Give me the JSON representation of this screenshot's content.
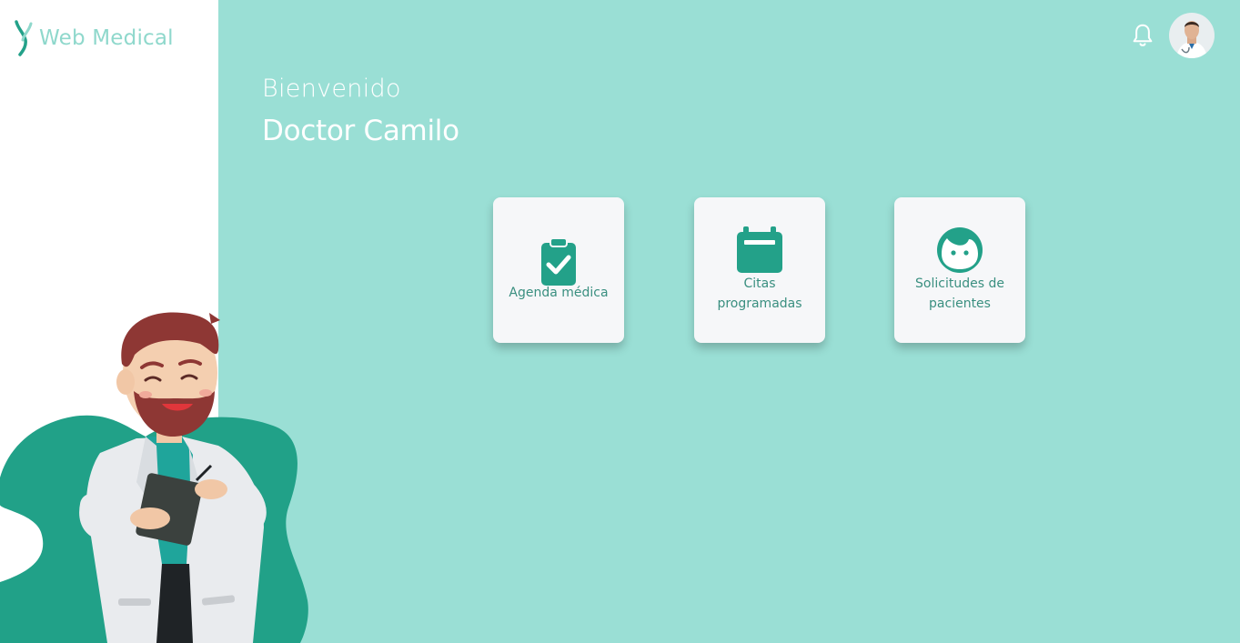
{
  "brand": {
    "name": "Web Medical",
    "color": "#8fd8cc",
    "accent": "#23a189"
  },
  "header": {
    "notification_icon": "bell-icon",
    "avatar_icon": "doctor-avatar"
  },
  "welcome": {
    "greeting": "Bienvenido",
    "name": "Doctor Camilo"
  },
  "cards": [
    {
      "icon": "clipboard-check-icon",
      "label": "Agenda médica"
    },
    {
      "icon": "calendar-icon",
      "label": "Citas programadas"
    },
    {
      "icon": "patient-face-icon",
      "label": "Solicitudes de pacientes"
    }
  ],
  "colors": {
    "background": "#9adfd5",
    "sidebar": "#ffffff",
    "card": "#f6f7f9",
    "icon": "#23a189",
    "text_white": "#ffffff"
  }
}
